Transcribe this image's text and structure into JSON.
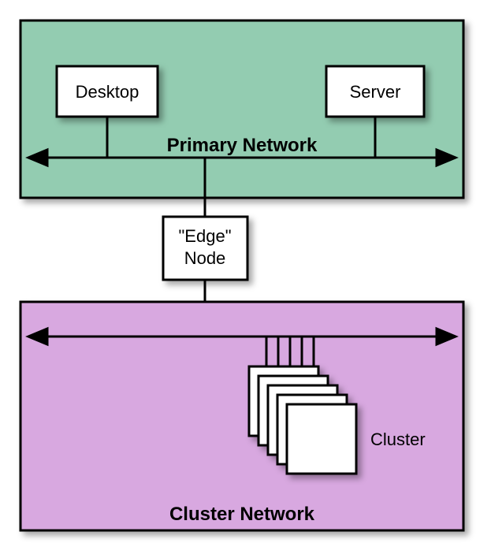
{
  "diagram": {
    "primary_network": {
      "label": "Primary Network",
      "fill": "#93ccb1",
      "nodes": {
        "desktop": {
          "label": "Desktop"
        },
        "server": {
          "label": "Server"
        }
      }
    },
    "edge_node": {
      "label_line1": "\"Edge\"",
      "label_line2": "Node"
    },
    "cluster_network": {
      "label": "Cluster Network",
      "fill": "#d8a8e0",
      "cluster_label": "Cluster"
    }
  }
}
